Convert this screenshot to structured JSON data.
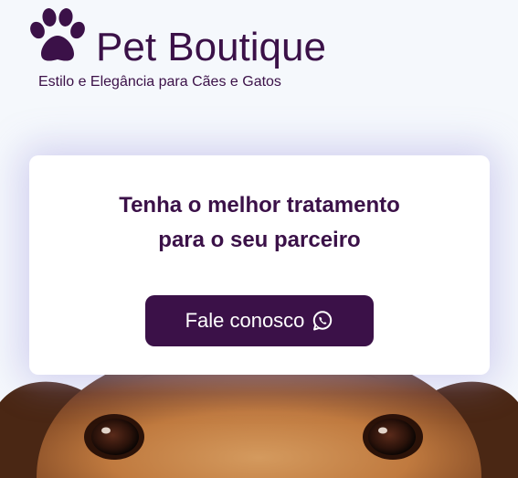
{
  "brand": {
    "logo_icon": "paw-icon",
    "name": "Pet Boutique",
    "tagline": "Estilo e Elegância para Cães e Gatos"
  },
  "hero": {
    "headline_line1": "Tenha o melhor tratamento",
    "headline_line2": "para o seu parceiro",
    "cta_label": "Fale conosco",
    "cta_icon": "whatsapp-icon",
    "image_subject": "dog-face-photo"
  },
  "colors": {
    "brand": "#3b1148",
    "background": "#f5f8fc",
    "card": "#ffffff",
    "button_text": "#ffffff"
  }
}
